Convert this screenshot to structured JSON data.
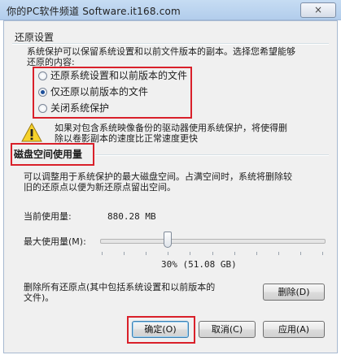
{
  "window": {
    "title": "你的PC软件频道 Software.it168.com",
    "close_label": "×"
  },
  "restore_settings": {
    "group_label": "还原设置",
    "description_line1": "系统保护可以保留系统设置和以前文件版本的副本。选择您希望能够",
    "description_line2": "还原的内容:",
    "options": [
      {
        "label": "还原系统设置和以前版本的文件",
        "checked": false
      },
      {
        "label": "仅还原以前版本的文件",
        "checked": true
      },
      {
        "label": "关闭系统保护",
        "checked": false
      }
    ],
    "warning_line1": "如果对包含系统映像备份的驱动器使用系统保护，将使得删",
    "warning_line2": "除以卷影副本的速度比正常速度更快"
  },
  "disk_usage": {
    "section_title": "磁盘空间使用量",
    "description_line1": "可以调整用于系统保护的最大磁盘空间。占满空间时，系统将删除较",
    "description_line2": "旧的还原点以便为新还原点留出空间。",
    "current_usage_label": "当前使用量:",
    "current_usage_value": "880.28 MB",
    "max_usage_label": "最大使用量(M):",
    "max_usage_fraction": 0.3,
    "max_usage_value": "30% (51.08 GB)"
  },
  "delete_section": {
    "text_line1": "删除所有还原点(其中包括系统设置和以前版本的",
    "text_line2": "文件)。",
    "delete_button": "删除(D)"
  },
  "footer": {
    "ok_button": "确定(O)",
    "cancel_button": "取消(C)",
    "apply_button": "应用(A)"
  },
  "colors": {
    "highlight_box": "#d9202a",
    "window_bg": "#f0f0f0",
    "titlebar": "#b2cdec"
  }
}
